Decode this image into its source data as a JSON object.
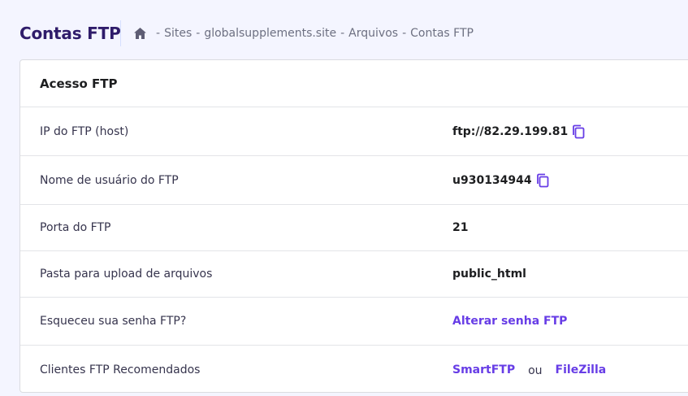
{
  "page": {
    "title": "Contas FTP"
  },
  "breadcrumb": {
    "home_icon": "home-icon",
    "separator": "-",
    "items": [
      "Sites",
      "globalsupplements.site",
      "Arquivos",
      "Contas FTP"
    ]
  },
  "card": {
    "title": "Acesso FTP",
    "rows": [
      {
        "label": "IP do FTP (host)",
        "value": "ftp://82.29.199.81",
        "copy_icon": "copy-icon"
      },
      {
        "label": "Nome de usuário do FTP",
        "value": "u930134944",
        "copy_icon": "copy-icon"
      },
      {
        "label": "Porta do FTP",
        "value": "21"
      },
      {
        "label": "Pasta para upload de arquivos",
        "value": "public_html"
      },
      {
        "label": "Esqueceu sua senha FTP?",
        "link": "Alterar senha FTP"
      },
      {
        "label": "Clientes FTP Recomendados",
        "link1": "SmartFTP",
        "or": "ou",
        "link2": "FileZilla"
      }
    ]
  },
  "colors": {
    "accent": "#673de6",
    "title": "#2f1c6a",
    "background": "#f4f5ff"
  }
}
